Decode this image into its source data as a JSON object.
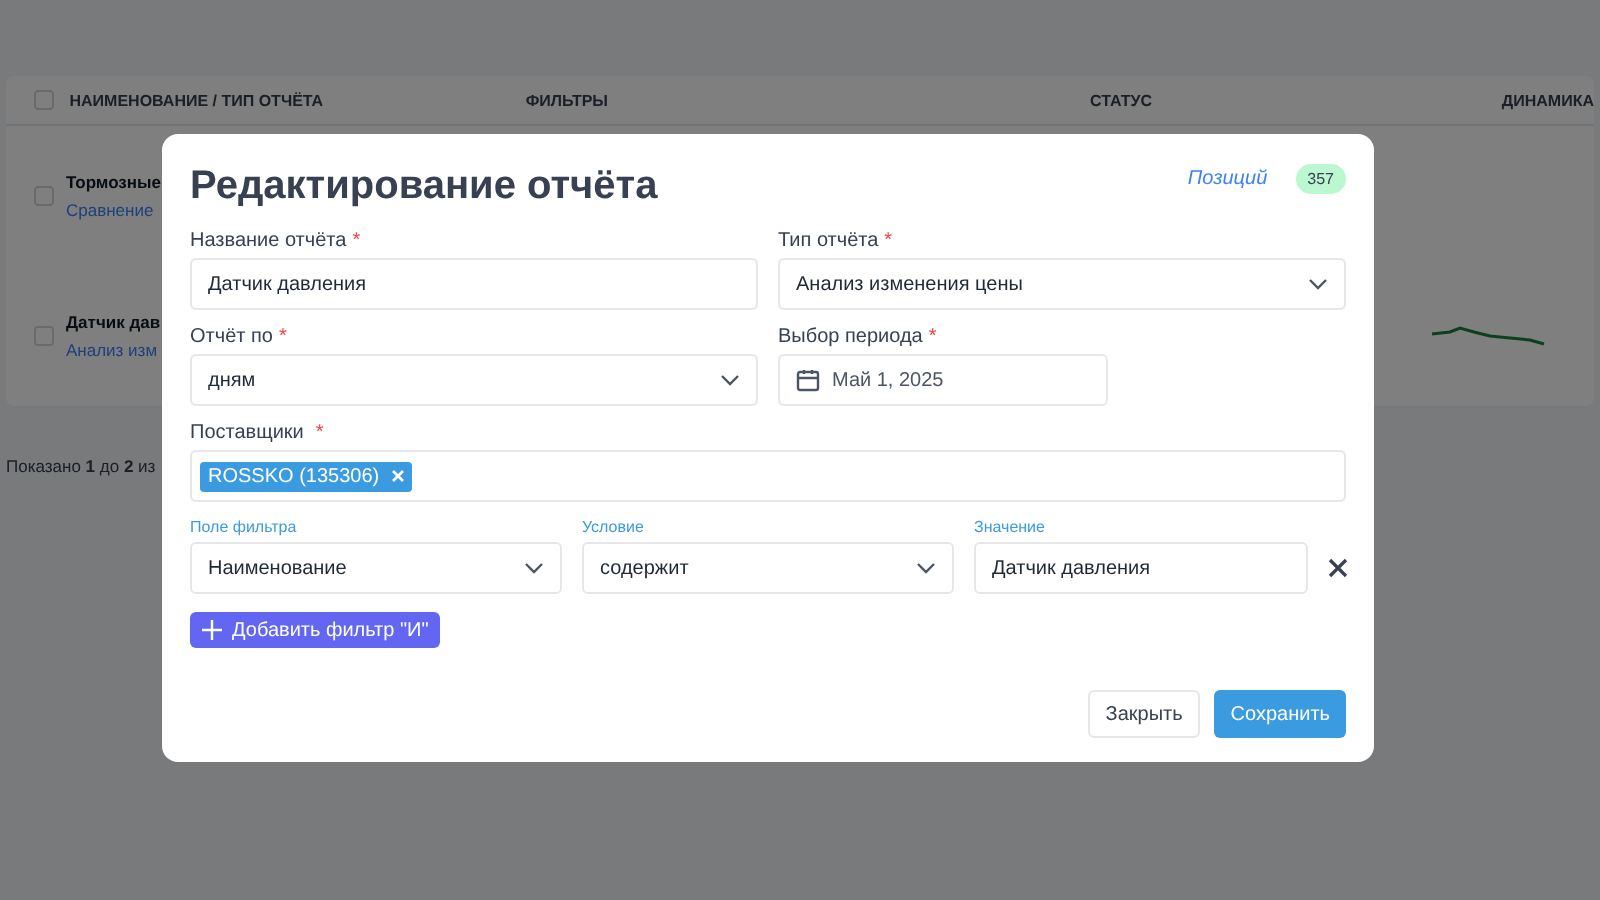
{
  "background": {
    "all_checked": false,
    "columns": [
      "НАИМЕНОВАНИЕ / ТИП ОТЧЁТА",
      "ФИЛЬТРЫ",
      "СТАТУС",
      "ДИНАМИКА"
    ],
    "rows": [
      {
        "name": "Тормозные",
        "type": "Сравнение",
        "checked": false
      },
      {
        "name": "Датчик дав",
        "type": "Анализ изм",
        "checked": false
      }
    ],
    "footer": {
      "before": "Показано ",
      "from": "1",
      "middle": " до ",
      "to": "2",
      "after": " из"
    }
  },
  "modal": {
    "title": "Редактирование отчёта",
    "positions_label": "Позиций",
    "positions_count": "357",
    "name": {
      "label": "Название отчёта",
      "required_mark": "*",
      "value": "Датчик давления"
    },
    "type": {
      "label": "Тип отчёта",
      "required_mark": "*",
      "value": "Анализ изменения цены"
    },
    "report_by": {
      "label": "Отчёт по",
      "required_mark": "*",
      "value": "дням"
    },
    "period": {
      "label": "Выбор периода",
      "required_mark": "*",
      "value": "Май 1, 2025"
    },
    "suppliers": {
      "label": "Поставщики",
      "required_mark": "*",
      "tags": [
        "ROSSKO (135306)"
      ]
    },
    "filter": {
      "field_label": "Поле фильтра",
      "field_value": "Наименование",
      "condition_label": "Условие",
      "condition_value": "содержит",
      "value_label": "Значение",
      "value": "Датчик давления"
    },
    "add_filter": "Добавить фильтр \"И\"",
    "buttons": {
      "close": "Закрыть",
      "save": "Сохранить"
    }
  }
}
